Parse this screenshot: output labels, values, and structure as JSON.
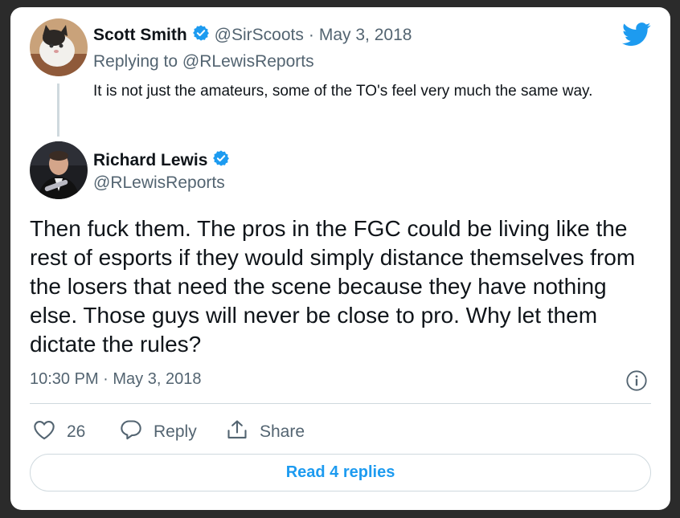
{
  "reply_tweet": {
    "author_name": "Scott Smith",
    "handle": "@SirScoots",
    "separator": "·",
    "date": "May 3, 2018",
    "replying_prefix": "Replying to",
    "replying_to": "@RLewisReports",
    "text": "It is not just the amateurs, some of the TO's feel very much the same way."
  },
  "main_tweet": {
    "author_name": "Richard Lewis",
    "handle": "@RLewisReports",
    "text": "Then fuck them. The pros in the FGC could be living like the rest of esports if they would simply distance themselves from the losers that need the scene because they have nothing else. Those guys will never be close to pro. Why let them dictate the rules?",
    "timestamp": "10:30 PM · May 3, 2018"
  },
  "actions": {
    "like_count": "26",
    "reply_label": "Reply",
    "share_label": "Share"
  },
  "read_replies_label": "Read 4 replies",
  "icons": {
    "brand": "twitter-bird-icon",
    "verified": "verified-badge-icon",
    "info": "info-icon",
    "like": "heart-icon",
    "reply": "comment-bubble-icon",
    "share": "share-icon"
  },
  "colors": {
    "accent": "#1d9bf0",
    "text": "#0f1419",
    "muted": "#536471",
    "border": "#cfd9de"
  }
}
